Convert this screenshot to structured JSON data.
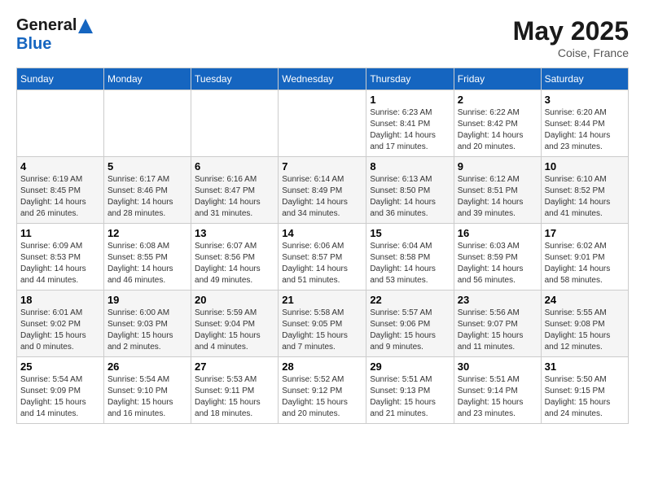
{
  "header": {
    "logo_line1": "General",
    "logo_line2": "Blue",
    "month_title": "May 2025",
    "location": "Coise, France"
  },
  "days_of_week": [
    "Sunday",
    "Monday",
    "Tuesday",
    "Wednesday",
    "Thursday",
    "Friday",
    "Saturday"
  ],
  "weeks": [
    [
      {
        "day": "",
        "info": ""
      },
      {
        "day": "",
        "info": ""
      },
      {
        "day": "",
        "info": ""
      },
      {
        "day": "",
        "info": ""
      },
      {
        "day": "1",
        "info": "Sunrise: 6:23 AM\nSunset: 8:41 PM\nDaylight: 14 hours\nand 17 minutes."
      },
      {
        "day": "2",
        "info": "Sunrise: 6:22 AM\nSunset: 8:42 PM\nDaylight: 14 hours\nand 20 minutes."
      },
      {
        "day": "3",
        "info": "Sunrise: 6:20 AM\nSunset: 8:44 PM\nDaylight: 14 hours\nand 23 minutes."
      }
    ],
    [
      {
        "day": "4",
        "info": "Sunrise: 6:19 AM\nSunset: 8:45 PM\nDaylight: 14 hours\nand 26 minutes."
      },
      {
        "day": "5",
        "info": "Sunrise: 6:17 AM\nSunset: 8:46 PM\nDaylight: 14 hours\nand 28 minutes."
      },
      {
        "day": "6",
        "info": "Sunrise: 6:16 AM\nSunset: 8:47 PM\nDaylight: 14 hours\nand 31 minutes."
      },
      {
        "day": "7",
        "info": "Sunrise: 6:14 AM\nSunset: 8:49 PM\nDaylight: 14 hours\nand 34 minutes."
      },
      {
        "day": "8",
        "info": "Sunrise: 6:13 AM\nSunset: 8:50 PM\nDaylight: 14 hours\nand 36 minutes."
      },
      {
        "day": "9",
        "info": "Sunrise: 6:12 AM\nSunset: 8:51 PM\nDaylight: 14 hours\nand 39 minutes."
      },
      {
        "day": "10",
        "info": "Sunrise: 6:10 AM\nSunset: 8:52 PM\nDaylight: 14 hours\nand 41 minutes."
      }
    ],
    [
      {
        "day": "11",
        "info": "Sunrise: 6:09 AM\nSunset: 8:53 PM\nDaylight: 14 hours\nand 44 minutes."
      },
      {
        "day": "12",
        "info": "Sunrise: 6:08 AM\nSunset: 8:55 PM\nDaylight: 14 hours\nand 46 minutes."
      },
      {
        "day": "13",
        "info": "Sunrise: 6:07 AM\nSunset: 8:56 PM\nDaylight: 14 hours\nand 49 minutes."
      },
      {
        "day": "14",
        "info": "Sunrise: 6:06 AM\nSunset: 8:57 PM\nDaylight: 14 hours\nand 51 minutes."
      },
      {
        "day": "15",
        "info": "Sunrise: 6:04 AM\nSunset: 8:58 PM\nDaylight: 14 hours\nand 53 minutes."
      },
      {
        "day": "16",
        "info": "Sunrise: 6:03 AM\nSunset: 8:59 PM\nDaylight: 14 hours\nand 56 minutes."
      },
      {
        "day": "17",
        "info": "Sunrise: 6:02 AM\nSunset: 9:01 PM\nDaylight: 14 hours\nand 58 minutes."
      }
    ],
    [
      {
        "day": "18",
        "info": "Sunrise: 6:01 AM\nSunset: 9:02 PM\nDaylight: 15 hours\nand 0 minutes."
      },
      {
        "day": "19",
        "info": "Sunrise: 6:00 AM\nSunset: 9:03 PM\nDaylight: 15 hours\nand 2 minutes."
      },
      {
        "day": "20",
        "info": "Sunrise: 5:59 AM\nSunset: 9:04 PM\nDaylight: 15 hours\nand 4 minutes."
      },
      {
        "day": "21",
        "info": "Sunrise: 5:58 AM\nSunset: 9:05 PM\nDaylight: 15 hours\nand 7 minutes."
      },
      {
        "day": "22",
        "info": "Sunrise: 5:57 AM\nSunset: 9:06 PM\nDaylight: 15 hours\nand 9 minutes."
      },
      {
        "day": "23",
        "info": "Sunrise: 5:56 AM\nSunset: 9:07 PM\nDaylight: 15 hours\nand 11 minutes."
      },
      {
        "day": "24",
        "info": "Sunrise: 5:55 AM\nSunset: 9:08 PM\nDaylight: 15 hours\nand 12 minutes."
      }
    ],
    [
      {
        "day": "25",
        "info": "Sunrise: 5:54 AM\nSunset: 9:09 PM\nDaylight: 15 hours\nand 14 minutes."
      },
      {
        "day": "26",
        "info": "Sunrise: 5:54 AM\nSunset: 9:10 PM\nDaylight: 15 hours\nand 16 minutes."
      },
      {
        "day": "27",
        "info": "Sunrise: 5:53 AM\nSunset: 9:11 PM\nDaylight: 15 hours\nand 18 minutes."
      },
      {
        "day": "28",
        "info": "Sunrise: 5:52 AM\nSunset: 9:12 PM\nDaylight: 15 hours\nand 20 minutes."
      },
      {
        "day": "29",
        "info": "Sunrise: 5:51 AM\nSunset: 9:13 PM\nDaylight: 15 hours\nand 21 minutes."
      },
      {
        "day": "30",
        "info": "Sunrise: 5:51 AM\nSunset: 9:14 PM\nDaylight: 15 hours\nand 23 minutes."
      },
      {
        "day": "31",
        "info": "Sunrise: 5:50 AM\nSunset: 9:15 PM\nDaylight: 15 hours\nand 24 minutes."
      }
    ]
  ]
}
